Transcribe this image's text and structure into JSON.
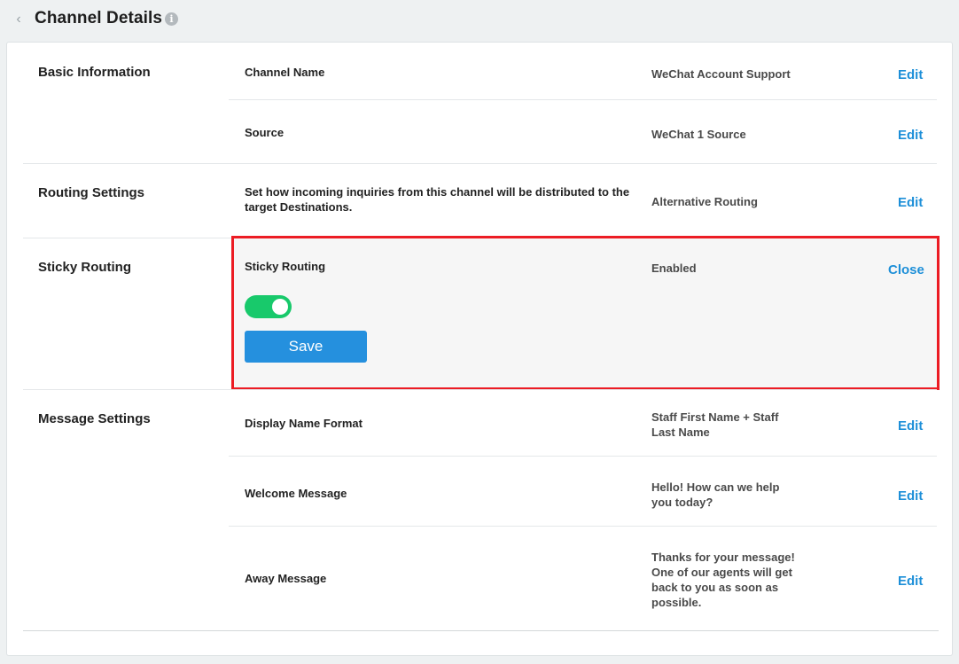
{
  "header": {
    "back_icon": "chevron-left-icon",
    "title": "Channel Details",
    "info_icon": "info-icon"
  },
  "sections": {
    "basic_information": {
      "title": "Basic Information",
      "rows": [
        {
          "label": "Channel Name",
          "value": "WeChat Account Support",
          "action": "Edit"
        },
        {
          "label": "Source",
          "value": "WeChat 1 Source",
          "action": "Edit"
        }
      ]
    },
    "routing_settings": {
      "title": "Routing Settings",
      "rows": [
        {
          "label": "Set how incoming inquiries from this channel will be distributed to the target Destinations.",
          "value": "Alternative Routing",
          "action": "Edit"
        }
      ]
    },
    "sticky_routing": {
      "title": "Sticky Routing",
      "label": "Sticky Routing",
      "value": "Enabled",
      "action": "Close",
      "toggle_on": true,
      "save_label": "Save"
    },
    "message_settings": {
      "title": "Message Settings",
      "rows": [
        {
          "label": "Display Name Format",
          "value": "Staff First Name + Staff Last Name",
          "action": "Edit"
        },
        {
          "label": "Welcome Message",
          "value": "Hello! How can we help you today?",
          "action": "Edit"
        },
        {
          "label": "Away Message",
          "value": "Thanks for your message! One of our agents will get back to you as soon as possible.",
          "action": "Edit"
        }
      ]
    }
  },
  "colors": {
    "accent": "#1d8fd8",
    "toggle_on": "#18c96b",
    "save_button": "#2590de",
    "highlight_border": "#ec1c24"
  }
}
